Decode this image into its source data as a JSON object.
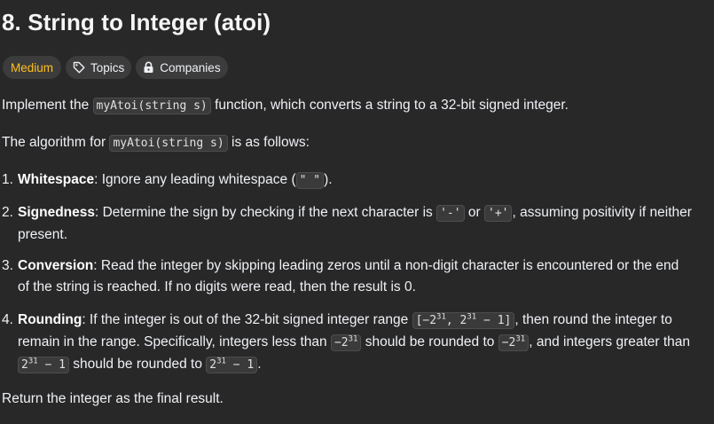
{
  "problem": {
    "title": "8. String to Integer (atoi)"
  },
  "tags": {
    "difficulty": "Medium",
    "topics": "Topics",
    "companies": "Companies"
  },
  "icons": {
    "topics": "tag-icon",
    "companies": "lock-icon"
  },
  "colors": {
    "background": "#282828",
    "difficulty_medium": "#ffc01e",
    "text": "#eff1f6"
  },
  "description": {
    "intro": {
      "before": "Implement the ",
      "code": "myAtoi(string s)",
      "after": " function, which converts a string to a 32-bit signed integer."
    },
    "algorithm": {
      "before": "The algorithm for ",
      "code": "myAtoi(string s)",
      "after": " is as follows:"
    },
    "steps": [
      {
        "num": "1.",
        "term": "Whitespace",
        "text1": ": Ignore any leading whitespace (",
        "code1": "\" \"",
        "text2": ")."
      },
      {
        "num": "2.",
        "term": "Signedness",
        "text1": ": Determine the sign by checking if the next character is ",
        "code1": "'-'",
        "text2": " or ",
        "code2": "'+'",
        "text3": ", assuming positivity if neither",
        "line2": "present."
      },
      {
        "num": "3.",
        "term": "Conversion",
        "text1": ": Read the integer by skipping leading zeros until a non-digit character is encountered or the end",
        "line2": "of the string is reached. If no digits were read, then the result is 0."
      },
      {
        "num": "4.",
        "term": "Rounding",
        "text1": ": If the integer is out of the 32-bit signed integer range ",
        "range_open": "[−2",
        "range_mid": ", 2",
        "range_close": " − 1]",
        "text2": ", then round the integer to",
        "line2_a": "remain in the range. Specifically, integers less than ",
        "neg_base": "−2",
        "line2_b": " should be rounded to ",
        "line2_c": ", and integers greater than",
        "pos_base": "2",
        "pos_minus": " − 1",
        "line3_a": " should be rounded to ",
        "line3_b": ".",
        "exponent": "31"
      }
    ],
    "closing": "Return the integer as the final result."
  }
}
